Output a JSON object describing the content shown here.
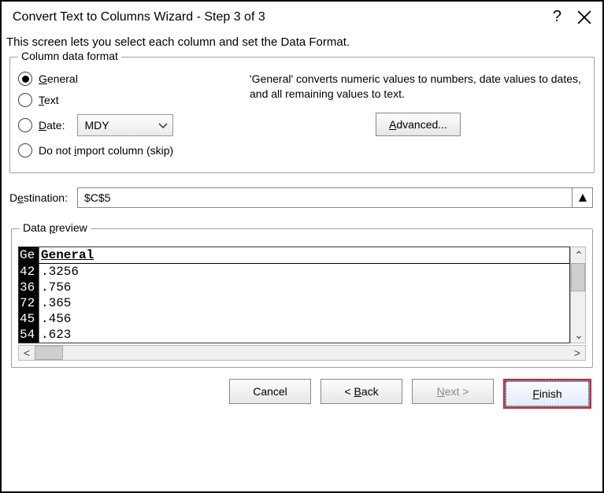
{
  "titlebar": {
    "title": "Convert Text to Columns Wizard - Step 3 of 3"
  },
  "description": "This screen lets you select each column and set the Data Format.",
  "column_format": {
    "legend": "Column data format",
    "general": "General",
    "text": "Text",
    "date": "Date:",
    "date_format": "MDY",
    "skip": "Do not import column (skip)",
    "selected": "general"
  },
  "hint": "'General' converts numeric values to numbers, date values to dates, and all remaining values to text.",
  "advanced_button": "Advanced...",
  "destination": {
    "label": "Destination:",
    "value": "$C$5"
  },
  "preview": {
    "legend": "Data preview",
    "header_col1": "Ge",
    "header_col2": "General",
    "rows": [
      {
        "c1": "42",
        "c2": ".3256"
      },
      {
        "c1": "36",
        "c2": ".756"
      },
      {
        "c1": "72",
        "c2": ".365"
      },
      {
        "c1": "45",
        "c2": ".456"
      },
      {
        "c1": "54",
        "c2": ".623"
      }
    ]
  },
  "buttons": {
    "cancel": "Cancel",
    "back": "< Back",
    "next": "Next >",
    "finish": "Finish"
  }
}
